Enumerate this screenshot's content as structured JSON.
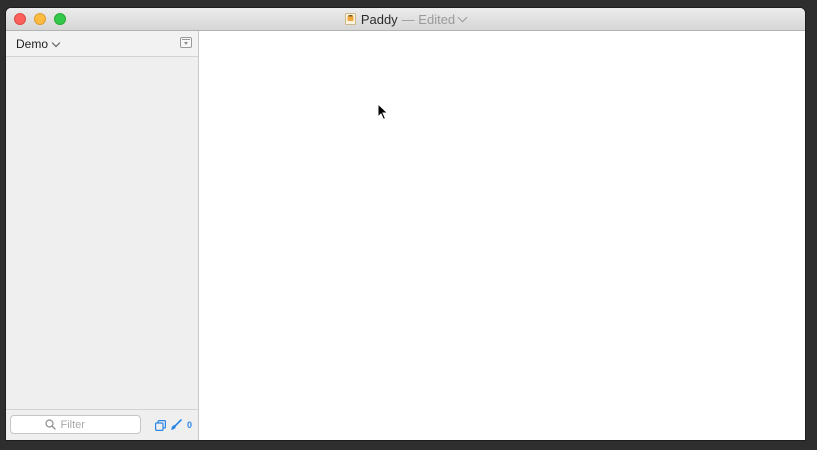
{
  "window": {
    "title": "Paddy",
    "status": "— Edited"
  },
  "sidebar": {
    "project": "Demo",
    "filter": {
      "placeholder": "Filter",
      "value": ""
    },
    "badge_count": "0"
  },
  "icons": {
    "document": "doc-icon",
    "sidebar_menu": "sidebar-menu-icon",
    "search": "search-icon",
    "duplicate": "duplicate-icon",
    "brush": "brush-icon",
    "cursor": "mouse-cursor-icon"
  },
  "colors": {
    "close": "#fc605c",
    "minimize": "#fdbc40",
    "zoom": "#34c84a",
    "accent": "#2b86e5"
  }
}
